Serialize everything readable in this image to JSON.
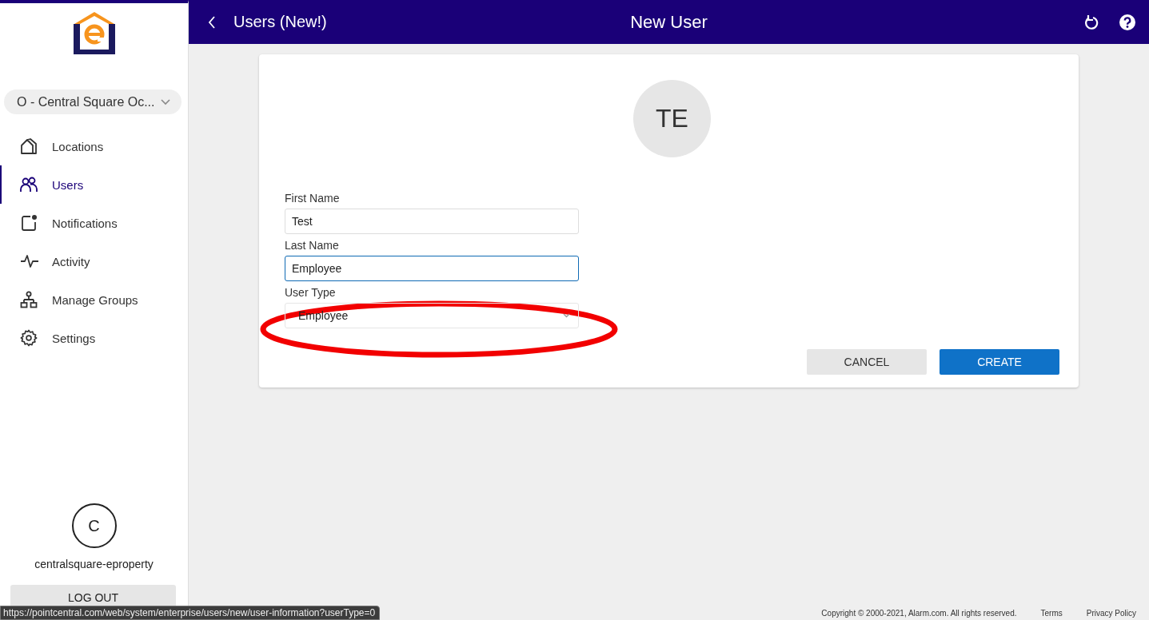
{
  "header": {
    "back_label": "Users (New!)",
    "title": "New User"
  },
  "sidebar": {
    "location_selector": "O - Central Square Oc...",
    "nav_items": [
      {
        "label": "Locations",
        "kind": "home",
        "selected": false
      },
      {
        "label": "Users",
        "kind": "people",
        "selected": true
      },
      {
        "label": "Notifications",
        "kind": "notification",
        "selected": false
      },
      {
        "label": "Activity",
        "kind": "pulse",
        "selected": false
      },
      {
        "label": "Manage Groups",
        "kind": "groups",
        "selected": false
      },
      {
        "label": "Settings",
        "kind": "gear",
        "selected": false
      }
    ],
    "account": {
      "initial": "C",
      "name": "centralsquare-eproperty"
    },
    "logout_button": "LOG OUT"
  },
  "form": {
    "avatar_initials": "TE",
    "fields": [
      {
        "label": "First Name",
        "value": "Test",
        "kind": "text",
        "focused": false
      },
      {
        "label": "Last Name",
        "value": "Employee",
        "kind": "text",
        "focused": true
      },
      {
        "label": "User Type",
        "value": "Employee",
        "kind": "select",
        "focused": false
      }
    ],
    "buttons": [
      {
        "label": "CANCEL",
        "kind": "secondary"
      },
      {
        "label": "CREATE",
        "kind": "primary"
      }
    ],
    "annotations": [
      {
        "kind": "ellipse"
      }
    ]
  },
  "footer": {
    "copyright": "Copyright © 2000-2021, Alarm.com. All rights reserved.",
    "links": [
      "Terms",
      "Privacy Policy"
    ]
  },
  "status_url": "https://pointcentral.com/web/system/enterprise/users/new/user-information?userType=0"
}
